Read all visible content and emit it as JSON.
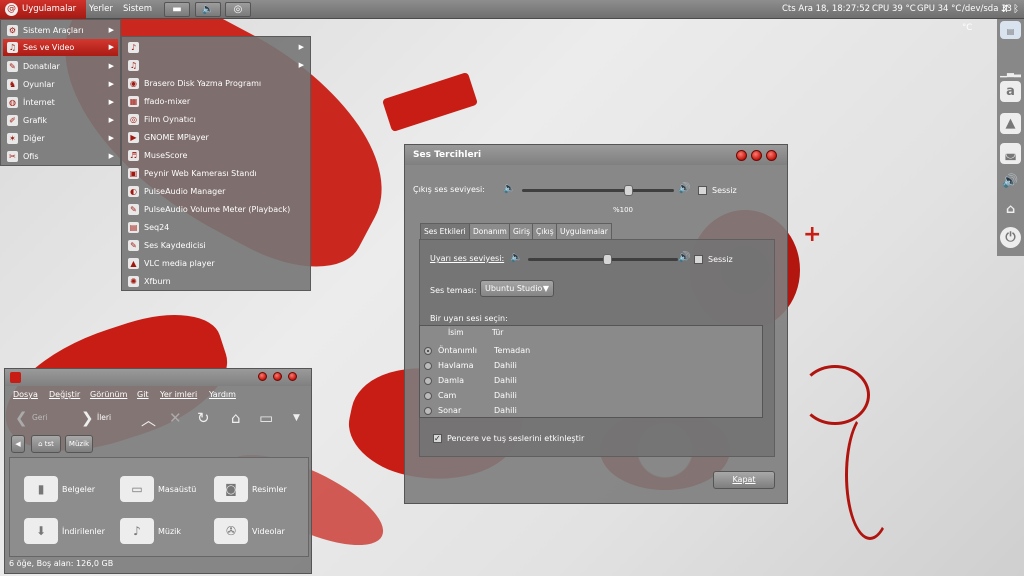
{
  "top_panel": {
    "applications": "Uygulamalar",
    "places": "Yerler",
    "system": "Sistem",
    "clock": "Cts Ara 18, 18:27:52",
    "cpu": "CPU 39 °C",
    "gpu": "GPU 34 °C",
    "disk": "/dev/sda 33 °C"
  },
  "app_menu": {
    "categories": [
      {
        "label": "Sistem Araçları",
        "icon": "gear-icon"
      },
      {
        "label": "Ses ve Video",
        "icon": "media-icon"
      },
      {
        "label": "Donatılar",
        "icon": "tools-icon"
      },
      {
        "label": "Oyunlar",
        "icon": "game-icon"
      },
      {
        "label": "İnternet",
        "icon": "globe-icon"
      },
      {
        "label": "Grafik",
        "icon": "paint-icon"
      },
      {
        "label": "Diğer",
        "icon": "star-icon"
      },
      {
        "label": "Ofis",
        "icon": "clip-icon"
      }
    ],
    "submenu": [
      {
        "label": "",
        "icon": "music-note-icon"
      },
      {
        "label": "",
        "icon": "media-icon"
      },
      {
        "label": "Brasero Disk Yazma Programı",
        "icon": "disc-icon"
      },
      {
        "label": "ffado-mixer",
        "icon": "mixer-icon"
      },
      {
        "label": "Film Oynatıcı",
        "icon": "film-icon"
      },
      {
        "label": "GNOME MPlayer",
        "icon": "play-icon"
      },
      {
        "label": "MuseScore",
        "icon": "score-icon"
      },
      {
        "label": "Peynir Web Kamerası Standı",
        "icon": "webcam-icon"
      },
      {
        "label": "PulseAudio Manager",
        "icon": "speaker-icon"
      },
      {
        "label": "PulseAudio Volume Meter (Playback)",
        "icon": "microphone-icon"
      },
      {
        "label": "Seq24",
        "icon": "seq-icon"
      },
      {
        "label": "Ses Kaydedicisi",
        "icon": "microphone-icon"
      },
      {
        "label": "VLC media player",
        "icon": "cone-icon"
      },
      {
        "label": "Xfburn",
        "icon": "burn-icon"
      }
    ]
  },
  "sound_prefs": {
    "title": "Ses Tercihleri",
    "output_volume_label": "Çıkış ses seviyesi:",
    "mute_label": "Sessiz",
    "output_volume_percent": "%100",
    "output_volume_value": 0.71,
    "tabs": [
      "Ses Etkileri",
      "Donanım",
      "Giriş",
      "Çıkış",
      "Uygulamalar"
    ],
    "alert_volume_label": "Uyarı ses seviyesi:",
    "alert_volume_value": 0.53,
    "theme_label": "Ses teması:",
    "theme_value": "Ubuntu Studio",
    "choose_alert_label": "Bir uyarı sesi seçin:",
    "col_name": "İsim",
    "col_type": "Tür",
    "alerts": [
      {
        "name": "Öntanımlı",
        "type": "Temadan",
        "selected": true
      },
      {
        "name": "Havlama",
        "type": "Dahili",
        "selected": false
      },
      {
        "name": "Damla",
        "type": "Dahili",
        "selected": false
      },
      {
        "name": "Cam",
        "type": "Dahili",
        "selected": false
      },
      {
        "name": "Sonar",
        "type": "Dahili",
        "selected": false
      }
    ],
    "window_sounds_label": "Pencere ve tuş seslerini etkinleştir",
    "close_label": "Kapat"
  },
  "file_manager": {
    "menus": [
      "Dosya",
      "Değiştir",
      "Görünüm",
      "Git",
      "Yer imleri",
      "Yardım"
    ],
    "back_label": "Geri",
    "forward_label": "İleri",
    "path_home": "tst",
    "path_music": "Müzik",
    "items": [
      {
        "label": "Belgeler",
        "icon": "document-icon"
      },
      {
        "label": "Masaüstü",
        "icon": "desktop-icon"
      },
      {
        "label": "Resimler",
        "icon": "camera-icon"
      },
      {
        "label": "İndirilenler",
        "icon": "download-icon"
      },
      {
        "label": "Müzik",
        "icon": "music-note-icon"
      },
      {
        "label": "Videolar",
        "icon": "film-icon"
      }
    ],
    "status": "6 öğe, Boş alan: 126,0 GB"
  },
  "colors": {
    "accent": "#c81d14",
    "panel": "#7a7a7a"
  }
}
